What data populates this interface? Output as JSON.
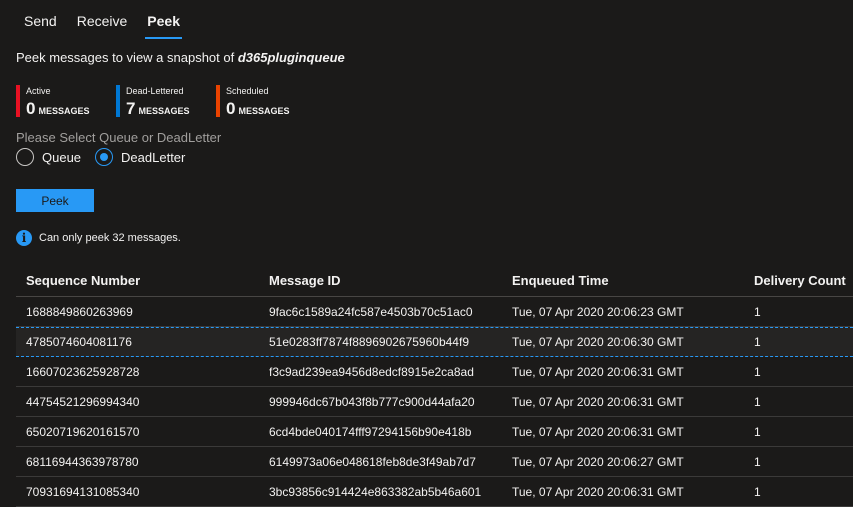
{
  "tabs": [
    {
      "label": "Send"
    },
    {
      "label": "Receive"
    },
    {
      "label": "Peek"
    }
  ],
  "description": {
    "prefix": "Peek messages to view a snapshot of ",
    "queue_name": "d365pluginqueue"
  },
  "counters": [
    {
      "label": "Active",
      "value": "0",
      "unit": "MESSAGES",
      "color": "#e81123"
    },
    {
      "label": "Dead-Lettered",
      "value": "7",
      "unit": "MESSAGES",
      "color": "#0078d4"
    },
    {
      "label": "Scheduled",
      "value": "0",
      "unit": "MESSAGES",
      "color": "#ea4300"
    }
  ],
  "selector": {
    "label": "Please Select Queue or DeadLetter",
    "options": [
      {
        "label": "Queue",
        "checked": false
      },
      {
        "label": "DeadLetter",
        "checked": true
      }
    ]
  },
  "peek_button": "Peek",
  "info_text": "Can only peek 32 messages.",
  "table": {
    "headers": [
      "Sequence Number",
      "Message ID",
      "Enqueued Time",
      "Delivery Count"
    ],
    "rows": [
      [
        "1688849860263969",
        "9fac6c1589a24fc587e4503b70c51ac0",
        "Tue, 07 Apr 2020 20:06:23 GMT",
        "1"
      ],
      [
        "4785074604081176",
        "51e0283ff7874f8896902675960b44f9",
        "Tue, 07 Apr 2020 20:06:30 GMT",
        "1"
      ],
      [
        "16607023625928728",
        "f3c9ad239ea9456d8edcf8915e2ca8ad",
        "Tue, 07 Apr 2020 20:06:31 GMT",
        "1"
      ],
      [
        "44754521296994340",
        "999946dc67b043f8b777c900d44afa20",
        "Tue, 07 Apr 2020 20:06:31 GMT",
        "1"
      ],
      [
        "65020719620161570",
        "6cd4bde040174fff97294156b90e418b",
        "Tue, 07 Apr 2020 20:06:31 GMT",
        "1"
      ],
      [
        "68116944363978780",
        "6149973a06e048618feb8de3f49ab7d7",
        "Tue, 07 Apr 2020 20:06:27 GMT",
        "1"
      ],
      [
        "70931694131085340",
        "3bc93856c914424e863382ab5b46a601",
        "Tue, 07 Apr 2020 20:06:31 GMT",
        "1"
      ]
    ],
    "selected_row": 1
  },
  "colors": {
    "accent": "#2899f5",
    "background": "#1b1a19"
  }
}
